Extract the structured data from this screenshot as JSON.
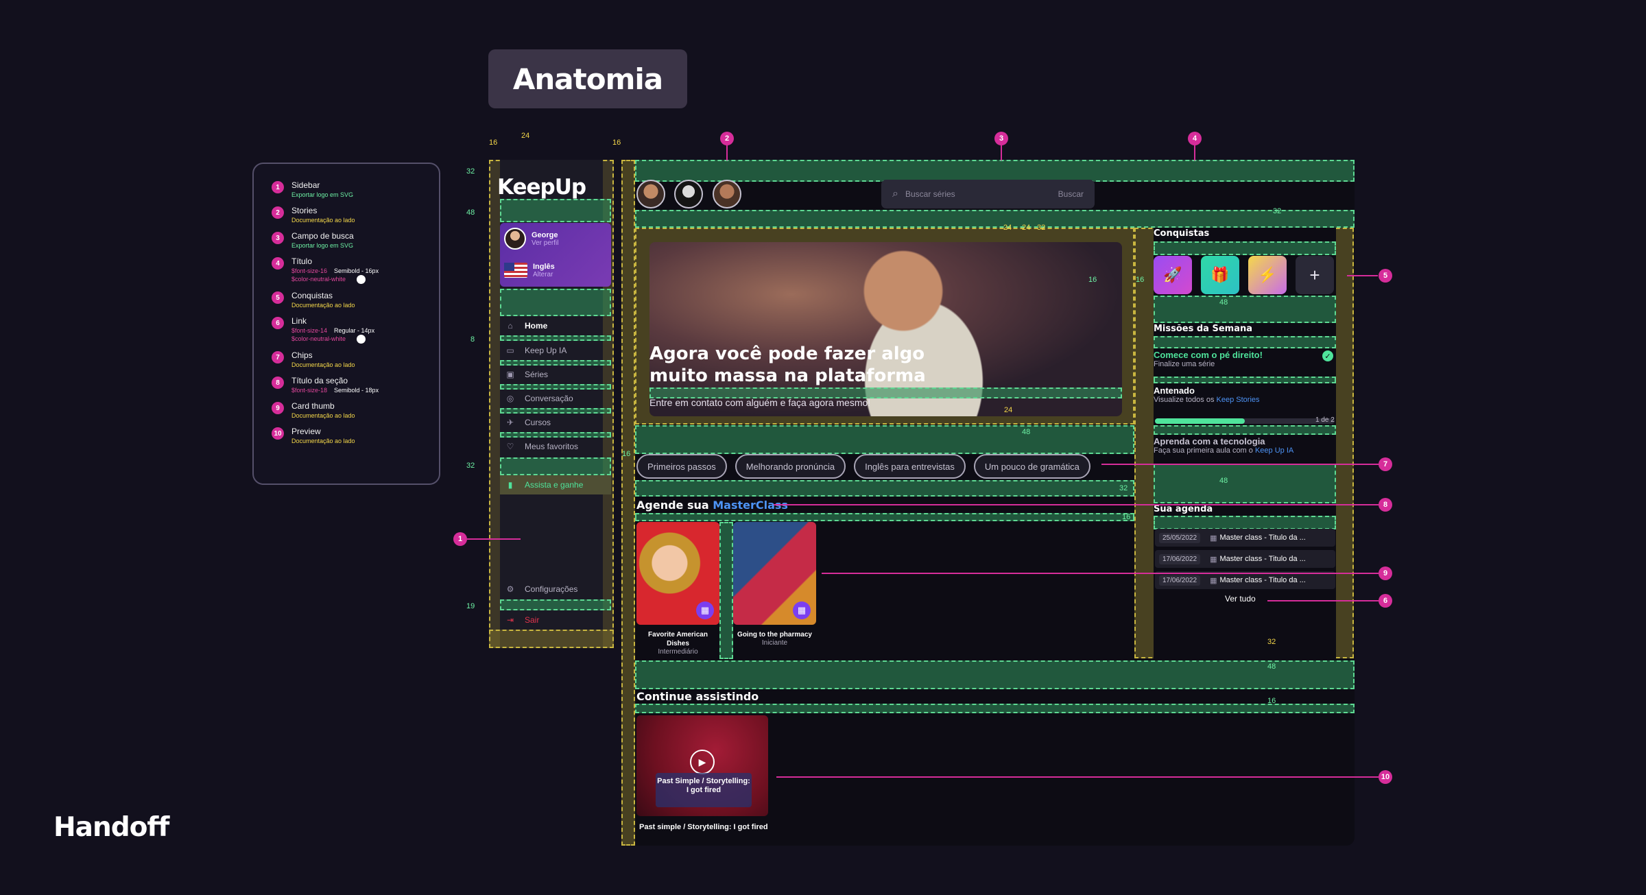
{
  "header": {
    "title": "Anatomia",
    "footer_brand": "Handoff"
  },
  "legend": [
    {
      "n": "1",
      "title": "Sidebar",
      "sub": "Exportar logo em SVG",
      "color": "green"
    },
    {
      "n": "2",
      "title": "Stories",
      "sub": "Documentação ao lado",
      "color": "yellow"
    },
    {
      "n": "3",
      "title": "Campo de busca",
      "sub": "Exportar logo em SVG",
      "color": "green"
    },
    {
      "n": "4",
      "title": "Título",
      "token1": "$font-size-16",
      "spec1": "Semibold - 16px",
      "token2": "$color-neutral-white"
    },
    {
      "n": "5",
      "title": "Conquistas",
      "sub": "Documentação ao lado",
      "color": "yellow"
    },
    {
      "n": "6",
      "title": "Link",
      "token1": "$font-size-14",
      "spec1": "Regular - 14px",
      "token2": "$color-neutral-white"
    },
    {
      "n": "7",
      "title": "Chips",
      "sub": "Documentação ao lado",
      "color": "yellow"
    },
    {
      "n": "8",
      "title": "Título da seção",
      "token1": "$font-size-18",
      "spec1": "Semibold - 18px"
    },
    {
      "n": "9",
      "title": "Card thumb",
      "sub": "Documentação ao lado",
      "color": "yellow"
    },
    {
      "n": "10",
      "title": "Preview",
      "sub": "Documentação ao lado",
      "color": "yellow"
    }
  ],
  "sidebar": {
    "logo": "KeepUp",
    "profile": {
      "name": "George",
      "sub": "Ver perfil"
    },
    "language": {
      "name": "Inglês",
      "sub": "Alterar"
    },
    "items": [
      {
        "icon": "home-icon",
        "glyph": "⌂",
        "label": "Home"
      },
      {
        "icon": "monitor-icon",
        "glyph": "▭",
        "label": "Keep Up IA"
      },
      {
        "icon": "video-icon",
        "glyph": "▣",
        "label": "Séries"
      },
      {
        "icon": "chat-icon",
        "glyph": "◎",
        "label": "Conversação"
      },
      {
        "icon": "rocket-icon",
        "glyph": "✈",
        "label": "Cursos"
      },
      {
        "icon": "heart-icon",
        "glyph": "♡",
        "label": "Meus favoritos"
      }
    ],
    "earn": {
      "glyph": "▮",
      "label": "Assista e ganhe"
    },
    "settings": {
      "glyph": "⚙",
      "label": "Configurações"
    },
    "logout": {
      "glyph": "⇥",
      "label": "Sair"
    }
  },
  "search": {
    "placeholder": "Buscar séries",
    "button": "Buscar"
  },
  "hero": {
    "heading": "Agora você pode fazer algo muito massa na plataforma",
    "sub": "Entre em contato com alguém e faça agora mesmo!"
  },
  "chips": [
    "Primeiros passos",
    "Melhorando pronúncia",
    "Inglês para entrevistas",
    "Um pouco de gramática"
  ],
  "masterclass": {
    "title_pre": "Agende sua",
    "title_accent": "MasterClass",
    "cards": [
      {
        "title": "Favorite American Dishes",
        "level": "Intermediário"
      },
      {
        "title": "Going to the pharmacy",
        "level": "Iniciante"
      }
    ]
  },
  "continue": {
    "title": "Continue assistindo",
    "preview_title": "Past Simple / Storytelling: I got fired",
    "caption": "Past simple / Storytelling: I got fired"
  },
  "right": {
    "achievements_title": "Conquistas",
    "missions_title": "Missões da Semana",
    "missions": [
      {
        "title": "Comece com o pé direito!",
        "sub": "Finalize uma série",
        "done": true
      },
      {
        "title": "Antenado",
        "sub_pre": "Visualize todos os ",
        "sub_link": "Keep Stories",
        "progress": "1 de 2",
        "progress_value": 0.5
      },
      {
        "title": "Aprenda  com a tecnologia",
        "sub_pre": "Faça sua primeira aula com o ",
        "sub_link": "Keep Up IA"
      }
    ],
    "agenda_title": "Sua agenda",
    "agenda": [
      {
        "date": "25/05/2022",
        "label": "Master class - Titulo da ..."
      },
      {
        "date": "17/06/2022",
        "label": "Master class - Titulo da ..."
      },
      {
        "date": "17/06/2022",
        "label": "Master class - Titulo da ..."
      }
    ],
    "see_all": "Ver tudo"
  },
  "dims": {
    "d16": "16",
    "d24": "24",
    "d32": "32",
    "d48": "48",
    "d8": "8",
    "d19": "19",
    "d38": "38",
    "d40": "40"
  },
  "colors": {
    "accent_pink": "#d62d9a",
    "accent_green": "#4fe39b",
    "accent_blue": "#4d93f5",
    "overlay_green": "#2e8c58",
    "overlay_yellow": "#7a6e2c"
  }
}
